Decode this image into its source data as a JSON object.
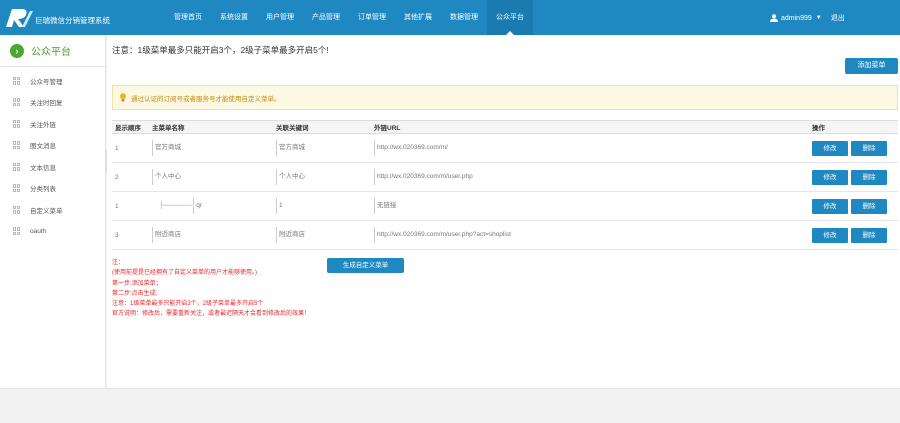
{
  "header": {
    "brand": "巨瑞微信分销管理系统",
    "nav": [
      "管理首页",
      "系统设置",
      "用户管理",
      "产品管理",
      "订单管理",
      "其他扩展",
      "数据管理",
      "公众平台"
    ],
    "active_nav": "公众平台",
    "user": "admin999",
    "logout": "退出"
  },
  "sidebar": {
    "title": "公众平台",
    "items": [
      "公众号管理",
      "关注时回复",
      "关注外链",
      "图文消息",
      "文本信息",
      "分类列表",
      "自定义菜单",
      "oauth"
    ]
  },
  "main": {
    "notice": "注意：1级菜单最多只能开启3个，2级子菜单最多开启5个!",
    "add_button": "添加菜单",
    "warning": "通过认证的订阅号或者服务号才能使用自定义菜单。",
    "table": {
      "headers": [
        "显示顺序",
        "主菜单名称",
        "关联关键词",
        "外链URL",
        "操作"
      ],
      "rows": [
        {
          "order": "1",
          "name": "官方商城",
          "keyword": "官方商城",
          "url": "http://wx.020369.com/m/"
        },
        {
          "order": "2",
          "name": "个人中心",
          "keyword": "个人中心",
          "url": "http://wx.020369.com/m/user.php"
        },
        {
          "order": "1",
          "name": "qr",
          "keyword": "1",
          "url": "无链接"
        },
        {
          "order": "3",
          "name": "附近商店",
          "keyword": "附近商店",
          "url": "http://wx.020369.com/m/user.php?act=shoplist"
        }
      ],
      "edit_label": "修改",
      "delete_label": "删除"
    },
    "generate_button": "生成自定义菜单",
    "notes": [
      "注：",
      "(使用前提是已经拥有了自定义菜单的用户才能够使用。)",
      "第一步:添加菜单；",
      "第二步:点击生成;",
      "注意：1级菜单最多只能开启3个，2级子菜单最多开启5个",
      "官方说明：修改后，需要重新关注，或者最迟隔天才会看到修改后的效果！"
    ]
  },
  "colors": {
    "primary": "#1f88c0",
    "sidebar_green": "#4ca72e",
    "warning_bg": "#fcf8e1",
    "note_red": "#e8262a"
  }
}
